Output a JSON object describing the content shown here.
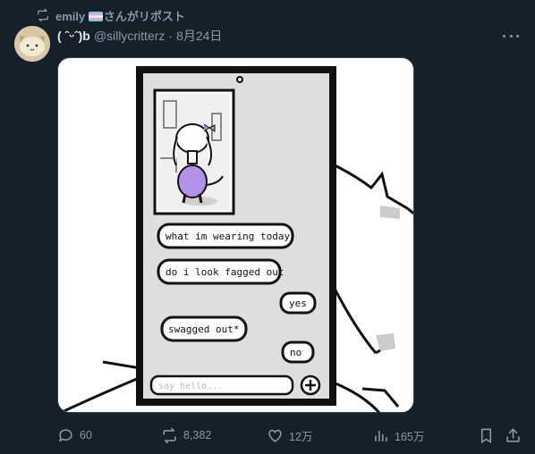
{
  "repost": {
    "user": "emily",
    "suffix": "さんがリポスト"
  },
  "author": {
    "display_name": "( ˆᵕˆ)b",
    "handle": "@sillycritterz",
    "separator": "·",
    "date": "8月24日"
  },
  "media": {
    "image": "comic-phone-chat",
    "bubbles": [
      "what im wearing today",
      "do i look fagged out",
      "yes",
      "swagged out*",
      "no"
    ],
    "input_placeholder": "say hello..."
  },
  "actions": {
    "replies": "60",
    "reposts": "8,382",
    "likes": "12万",
    "views": "165万"
  },
  "colors": {
    "background": "#15202b",
    "text": "#e7e9ea",
    "muted": "#8b98a5",
    "border": "#38444d"
  }
}
